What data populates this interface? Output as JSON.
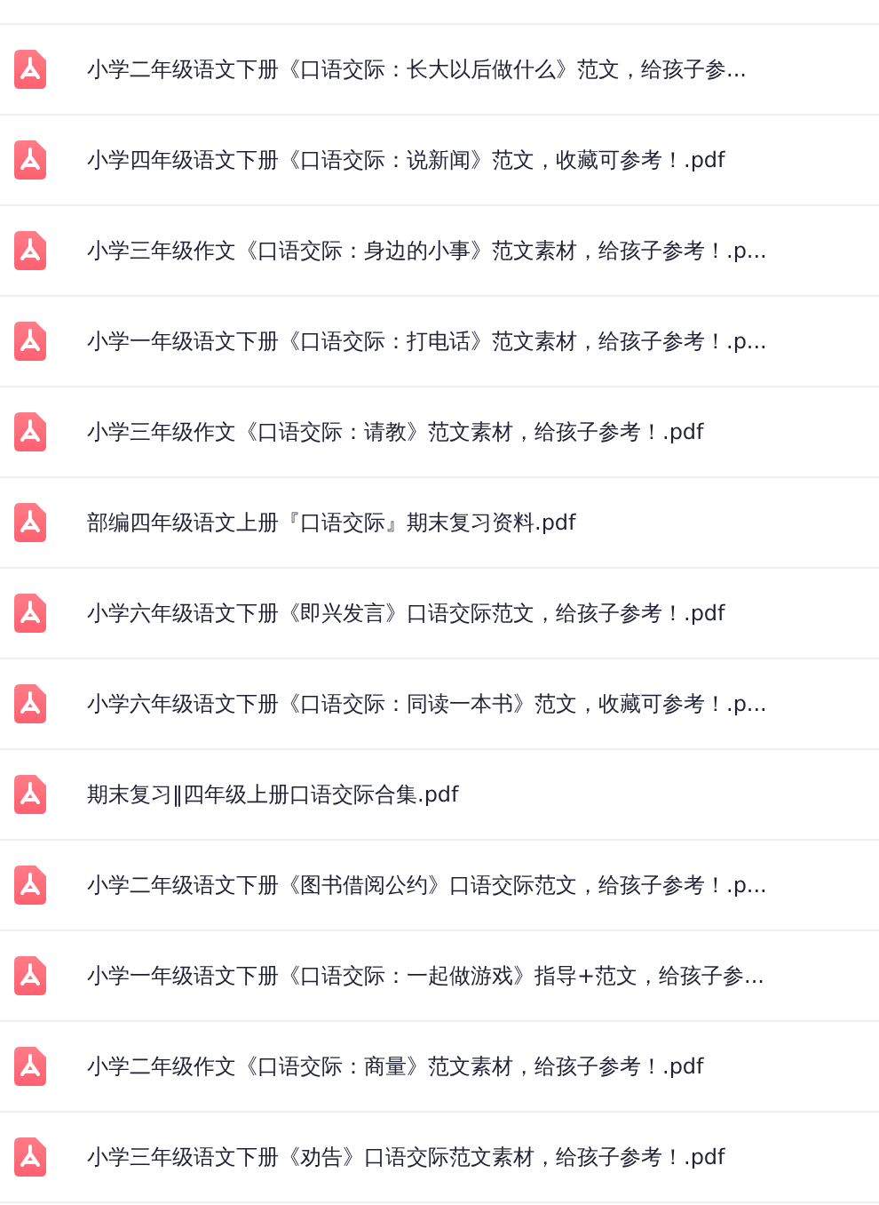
{
  "files": [
    {
      "name": "小学二年级语文下册《口语交际：长大以后做什么》范文，给孩子参..."
    },
    {
      "name": "小学四年级语文下册《口语交际：说新闻》范文，收藏可参考！.pdf"
    },
    {
      "name": "小学三年级作文《口语交际：身边的小事》范文素材，给孩子参考！.p..."
    },
    {
      "name": "小学一年级语文下册《口语交际：打电话》范文素材，给孩子参考！.p..."
    },
    {
      "name": "小学三年级作文《口语交际：请教》范文素材，给孩子参考！.pdf"
    },
    {
      "name": "部编四年级语文上册『口语交际』期末复习资料.pdf"
    },
    {
      "name": "小学六年级语文下册《即兴发言》口语交际范文，给孩子参考！.pdf"
    },
    {
      "name": "小学六年级语文下册《口语交际：同读一本书》范文，收藏可参考！.p..."
    },
    {
      "name": "期末复习‖四年级上册口语交际合集.pdf"
    },
    {
      "name": "小学二年级语文下册《图书借阅公约》口语交际范文，给孩子参考！.p..."
    },
    {
      "name": "小学一年级语文下册《口语交际：一起做游戏》指导+范文，给孩子参..."
    },
    {
      "name": "小学二年级作文《口语交际：商量》范文素材，给孩子参考！.pdf"
    },
    {
      "name": "小学三年级语文下册《劝告》口语交际范文素材，给孩子参考！.pdf"
    }
  ]
}
